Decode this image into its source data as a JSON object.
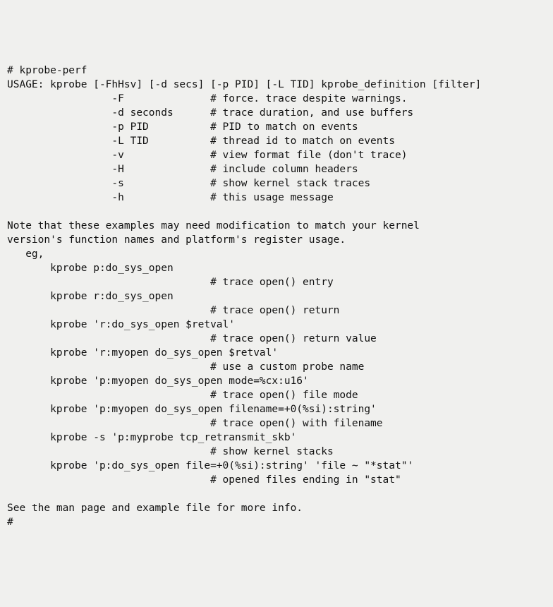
{
  "lines": [
    "# kprobe-perf",
    "USAGE: kprobe [-FhHsv] [-d secs] [-p PID] [-L TID] kprobe_definition [filter]",
    "                 -F              # force. trace despite warnings.",
    "                 -d seconds      # trace duration, and use buffers",
    "                 -p PID          # PID to match on events",
    "                 -L TID          # thread id to match on events",
    "                 -v              # view format file (don't trace)",
    "                 -H              # include column headers",
    "                 -s              # show kernel stack traces",
    "                 -h              # this usage message",
    "",
    "Note that these examples may need modification to match your kernel",
    "version's function names and platform's register usage.",
    "   eg,",
    "       kprobe p:do_sys_open",
    "                                 # trace open() entry",
    "       kprobe r:do_sys_open",
    "                                 # trace open() return",
    "       kprobe 'r:do_sys_open $retval'",
    "                                 # trace open() return value",
    "       kprobe 'r:myopen do_sys_open $retval'",
    "                                 # use a custom probe name",
    "       kprobe 'p:myopen do_sys_open mode=%cx:u16'",
    "                                 # trace open() file mode",
    "       kprobe 'p:myopen do_sys_open filename=+0(%si):string'",
    "                                 # trace open() with filename",
    "       kprobe -s 'p:myprobe tcp_retransmit_skb'",
    "                                 # show kernel stacks",
    "       kprobe 'p:do_sys_open file=+0(%si):string' 'file ~ \"*stat\"'",
    "                                 # opened files ending in \"stat\"",
    "",
    "See the man page and example file for more info.",
    "#"
  ]
}
